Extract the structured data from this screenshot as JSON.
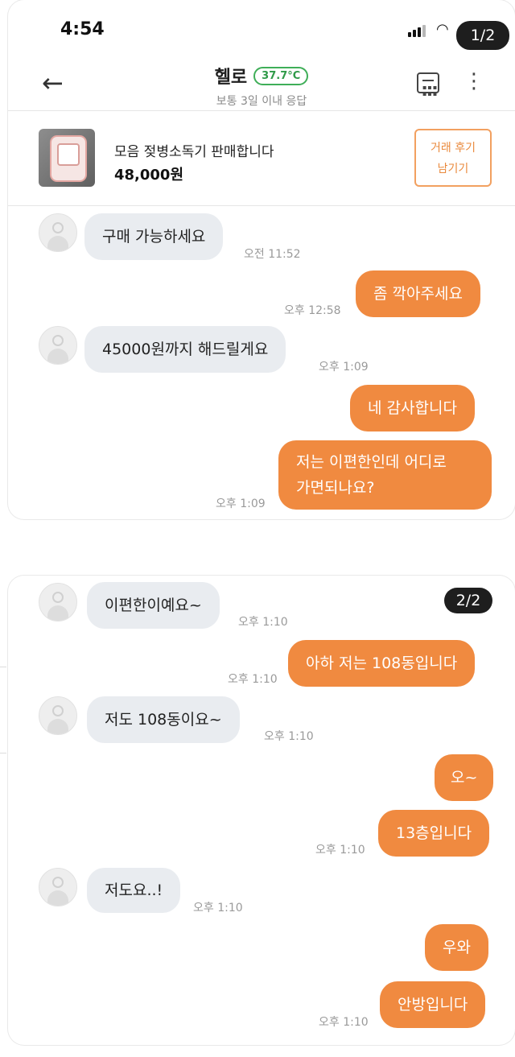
{
  "status_bar": {
    "time": "4:54"
  },
  "pages": {
    "first": "1/2",
    "second": "2/2"
  },
  "header": {
    "title": "헬로",
    "manner_temp": "37.7°C",
    "subtitle": "보통 3일 이내 응답"
  },
  "product": {
    "name": "모음 젖병소독기 판매합니다",
    "price": "48,000원",
    "review_line1": "거래 후기",
    "review_line2": "남기기"
  },
  "messages_page1": [
    {
      "from": "other",
      "text": "구매 가능하세요",
      "time": "오전 11:52"
    },
    {
      "from": "me",
      "text": "좀 깍아주세요",
      "time": "오후 12:58"
    },
    {
      "from": "other",
      "text": "45000원까지 해드릴게요",
      "time": "오후 1:09"
    },
    {
      "from": "me",
      "text": "네 감사합니다",
      "time": ""
    },
    {
      "from": "me",
      "line1": "저는 이편한인데 어디로",
      "line2": "가면되나요?",
      "time": "오후 1:09"
    }
  ],
  "messages_page2": [
    {
      "from": "other",
      "text": "이편한이예요~",
      "time": "오후 1:10"
    },
    {
      "from": "me",
      "text": "아하 저는 108동입니다",
      "time": "오후 1:10"
    },
    {
      "from": "other",
      "text": "저도 108동이요~",
      "time": "오후 1:10"
    },
    {
      "from": "me",
      "text": "오~",
      "time": ""
    },
    {
      "from": "me",
      "text": "13층입니다",
      "time": "오후 1:10"
    },
    {
      "from": "other",
      "text": "저도요..!",
      "time": "오후 1:10"
    },
    {
      "from": "me",
      "text": "우와",
      "time": ""
    },
    {
      "from": "me",
      "text": "안방입니다",
      "time": "오후 1:10"
    }
  ],
  "colors": {
    "accent": "#f08a40",
    "temp_green": "#3fae58",
    "incoming_bubble": "#e9ecf0"
  },
  "icons": [
    "back-arrow-icon",
    "calendar-icon",
    "more-vertical-icon",
    "signal-icon",
    "wifi-icon"
  ]
}
